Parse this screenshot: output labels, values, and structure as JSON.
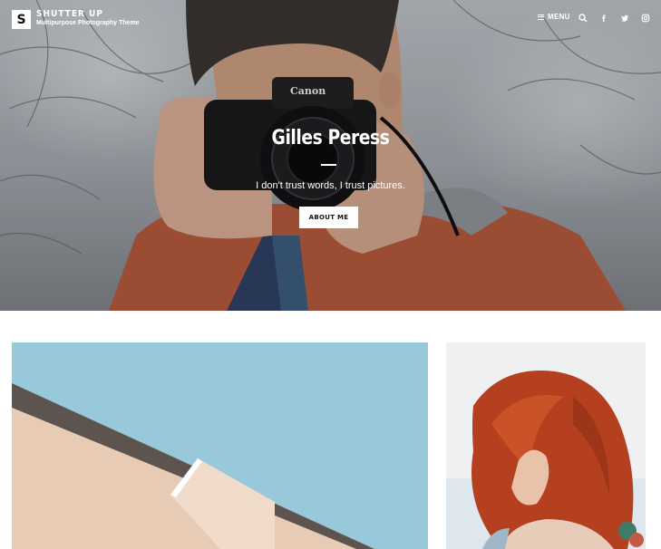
{
  "header": {
    "logo_letter": "S",
    "site_title": "SHUTTER UP",
    "tagline": "Multipurpose Photography Theme",
    "menu_label": "MENU",
    "icons": [
      "menu-icon",
      "search-icon",
      "facebook-icon",
      "twitter-icon",
      "instagram-icon"
    ]
  },
  "hero": {
    "title": "Gilles Peress",
    "quote": "I don't trust words, I trust pictures.",
    "button_label": "ABOUT ME",
    "camera_brand": "Canon"
  },
  "gallery": {
    "tiles": [
      "architecture-photo",
      "red-haired-woman-photo"
    ]
  },
  "colors": {
    "sky": "#8fc3d6",
    "jacket": "#b0583b",
    "hair": "#b5401f",
    "white": "#ffffff"
  }
}
